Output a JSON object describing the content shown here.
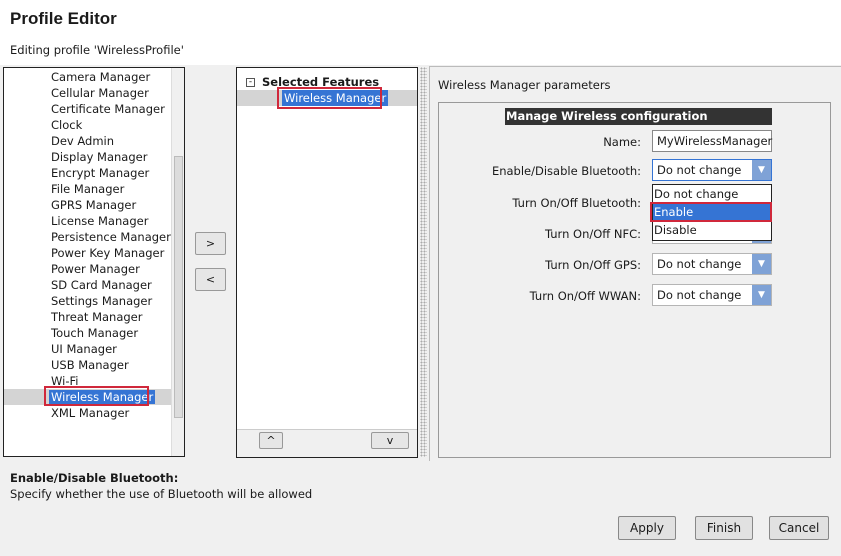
{
  "header": {
    "title": "Profile Editor",
    "subtitle": "Editing profile 'WirelessProfile'"
  },
  "features": {
    "items": [
      "Camera Manager",
      "Cellular Manager",
      "Certificate Manager",
      "Clock",
      "Dev Admin",
      "Display Manager",
      "Encrypt Manager",
      "File Manager",
      "GPRS Manager",
      "License Manager",
      "Persistence Manager",
      "Power Key Manager",
      "Power Manager",
      "SD Card Manager",
      "Settings Manager",
      "Threat Manager",
      "Touch Manager",
      "UI Manager",
      "USB Manager",
      "Wi-Fi",
      "Wireless Manager",
      "XML Manager"
    ],
    "selected": "Wireless Manager"
  },
  "transfer": {
    "add": ">",
    "remove": "<"
  },
  "selected_features": {
    "header": "Selected Features",
    "collapse_icon": "minus-box-icon",
    "items": [
      "Wireless Manager"
    ],
    "up": "^",
    "down": "v"
  },
  "params": {
    "title": "Wireless Manager parameters",
    "section": "Manage Wireless configuration",
    "name_label": "Name:",
    "name_value": "MyWirelessManager",
    "rows": [
      {
        "label": "Enable/Disable Bluetooth:",
        "value": "Do not change"
      },
      {
        "label": "Turn On/Off Bluetooth:",
        "value": "Do not change"
      },
      {
        "label": "Turn On/Off NFC:",
        "value": "Do not change"
      },
      {
        "label": "Turn On/Off GPS:",
        "value": "Do not change"
      },
      {
        "label": "Turn On/Off WWAN:",
        "value": "Do not change"
      }
    ],
    "dropdown_options": [
      "Do not change",
      "Enable",
      "Disable"
    ],
    "highlighted_option": "Enable"
  },
  "help": {
    "title": "Enable/Disable Bluetooth:",
    "text": "Specify whether the use of Bluetooth will be allowed"
  },
  "footer": {
    "apply": "Apply",
    "finish": "Finish",
    "cancel": "Cancel"
  },
  "colors": {
    "highlight": "#3574d4",
    "annotation": "#d0283b"
  }
}
